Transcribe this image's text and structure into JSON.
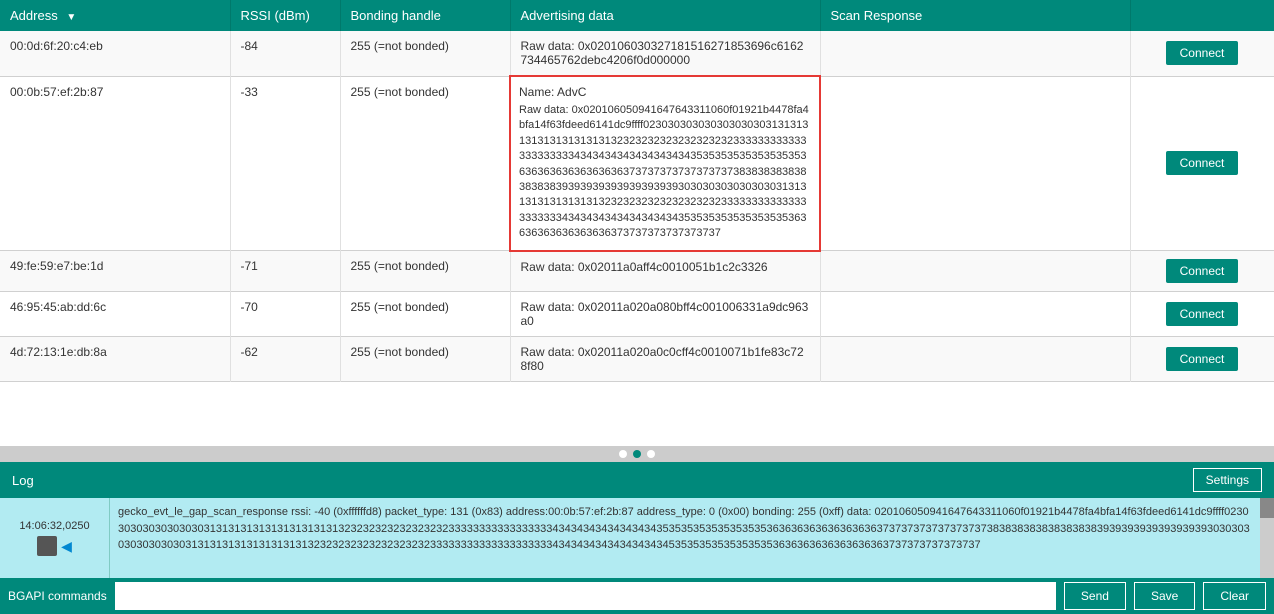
{
  "table": {
    "columns": [
      {
        "label": "Address",
        "sort": true
      },
      {
        "label": "RSSI (dBm)",
        "sort": false
      },
      {
        "label": "Bonding handle",
        "sort": false
      },
      {
        "label": "Advertising data",
        "sort": false
      },
      {
        "label": "Scan Response",
        "sort": false
      },
      {
        "label": "",
        "sort": false
      }
    ],
    "rows": [
      {
        "address": "00:0d:6f:20:c4:eb",
        "rssi": "-84",
        "bonding": "255 (=not bonded)",
        "adv_data": "Raw data: 0x020106030327181516271853696c6162734465762debc4206f0d000000",
        "scan_response": "",
        "connect_label": "Connect",
        "highlighted": false
      },
      {
        "address": "00:0b:57:ef:2b:87",
        "rssi": "-33",
        "bonding": "255 (=not bonded)",
        "adv_data_name": "Name: AdvC",
        "adv_data": "Raw data: 0x020106050941647643311060f01921b4478fa4bfa14f63fdeed6141dc9ffff023030303030303030303131313131313131313131323232323232323232323333333333333333333334343434343434343434353535353535353535363636363636363636373737373737373737383838383838383838393939393939393939393030303030303030313131313131313131323232323232323232323333333333333333333334343434343434343434353535353535353535363636363636363636373737373737373737",
        "scan_response": "",
        "connect_label": "Connect",
        "highlighted": true
      },
      {
        "address": "49:fe:59:e7:be:1d",
        "rssi": "-71",
        "bonding": "255 (=not bonded)",
        "adv_data": "Raw data: 0x02011a0aff4c0010051b1c2c3326",
        "scan_response": "",
        "connect_label": "Connect",
        "highlighted": false
      },
      {
        "address": "46:95:45:ab:dd:6c",
        "rssi": "-70",
        "bonding": "255 (=not bonded)",
        "adv_data": "Raw data: 0x02011a020a080bff4c001006331a9dc963a0",
        "scan_response": "",
        "connect_label": "Connect",
        "highlighted": false
      },
      {
        "address": "4d:72:13:1e:db:8a",
        "rssi": "-62",
        "bonding": "255 (=not bonded)",
        "adv_data": "Raw data: 0x02011a020a0c0cff4c0010071b1fe83c728f80",
        "scan_response": "",
        "connect_label": "Connect",
        "highlighted": false
      }
    ]
  },
  "pagination": {
    "dots": [
      false,
      true,
      false
    ]
  },
  "log": {
    "bar_label": "Log",
    "settings_label": "Settings",
    "timestamp": "14:06:32,0250",
    "log_text": "gecko_evt_le_gap_scan_response      rssi:   -40 (0xffffffd8) packet_type:   131 (0x83) address:00:0b:57:ef:2b:87 address_type:    0 (0x00) bonding:    255 (0xff) data: 020106050941647643311060f01921b4478fa4bfa14f63fdeed6141dc9ffff023030303030303030313131313131313131313132323232323232323233333333333333333434343434343434343535353535353535353636363636363636363737373737373737373838383838383838383939393939393939393030303030303030303131313131313131313132323232323232323232333333333333333333334343434343434343434535353535353535353636363636363636363737373737373737"
  },
  "command_bar": {
    "bgapi_label": "BGAPI commands",
    "input_placeholder": "",
    "input_value": "",
    "send_label": "Send",
    "save_label": "Save",
    "clear_label": "Clear"
  }
}
